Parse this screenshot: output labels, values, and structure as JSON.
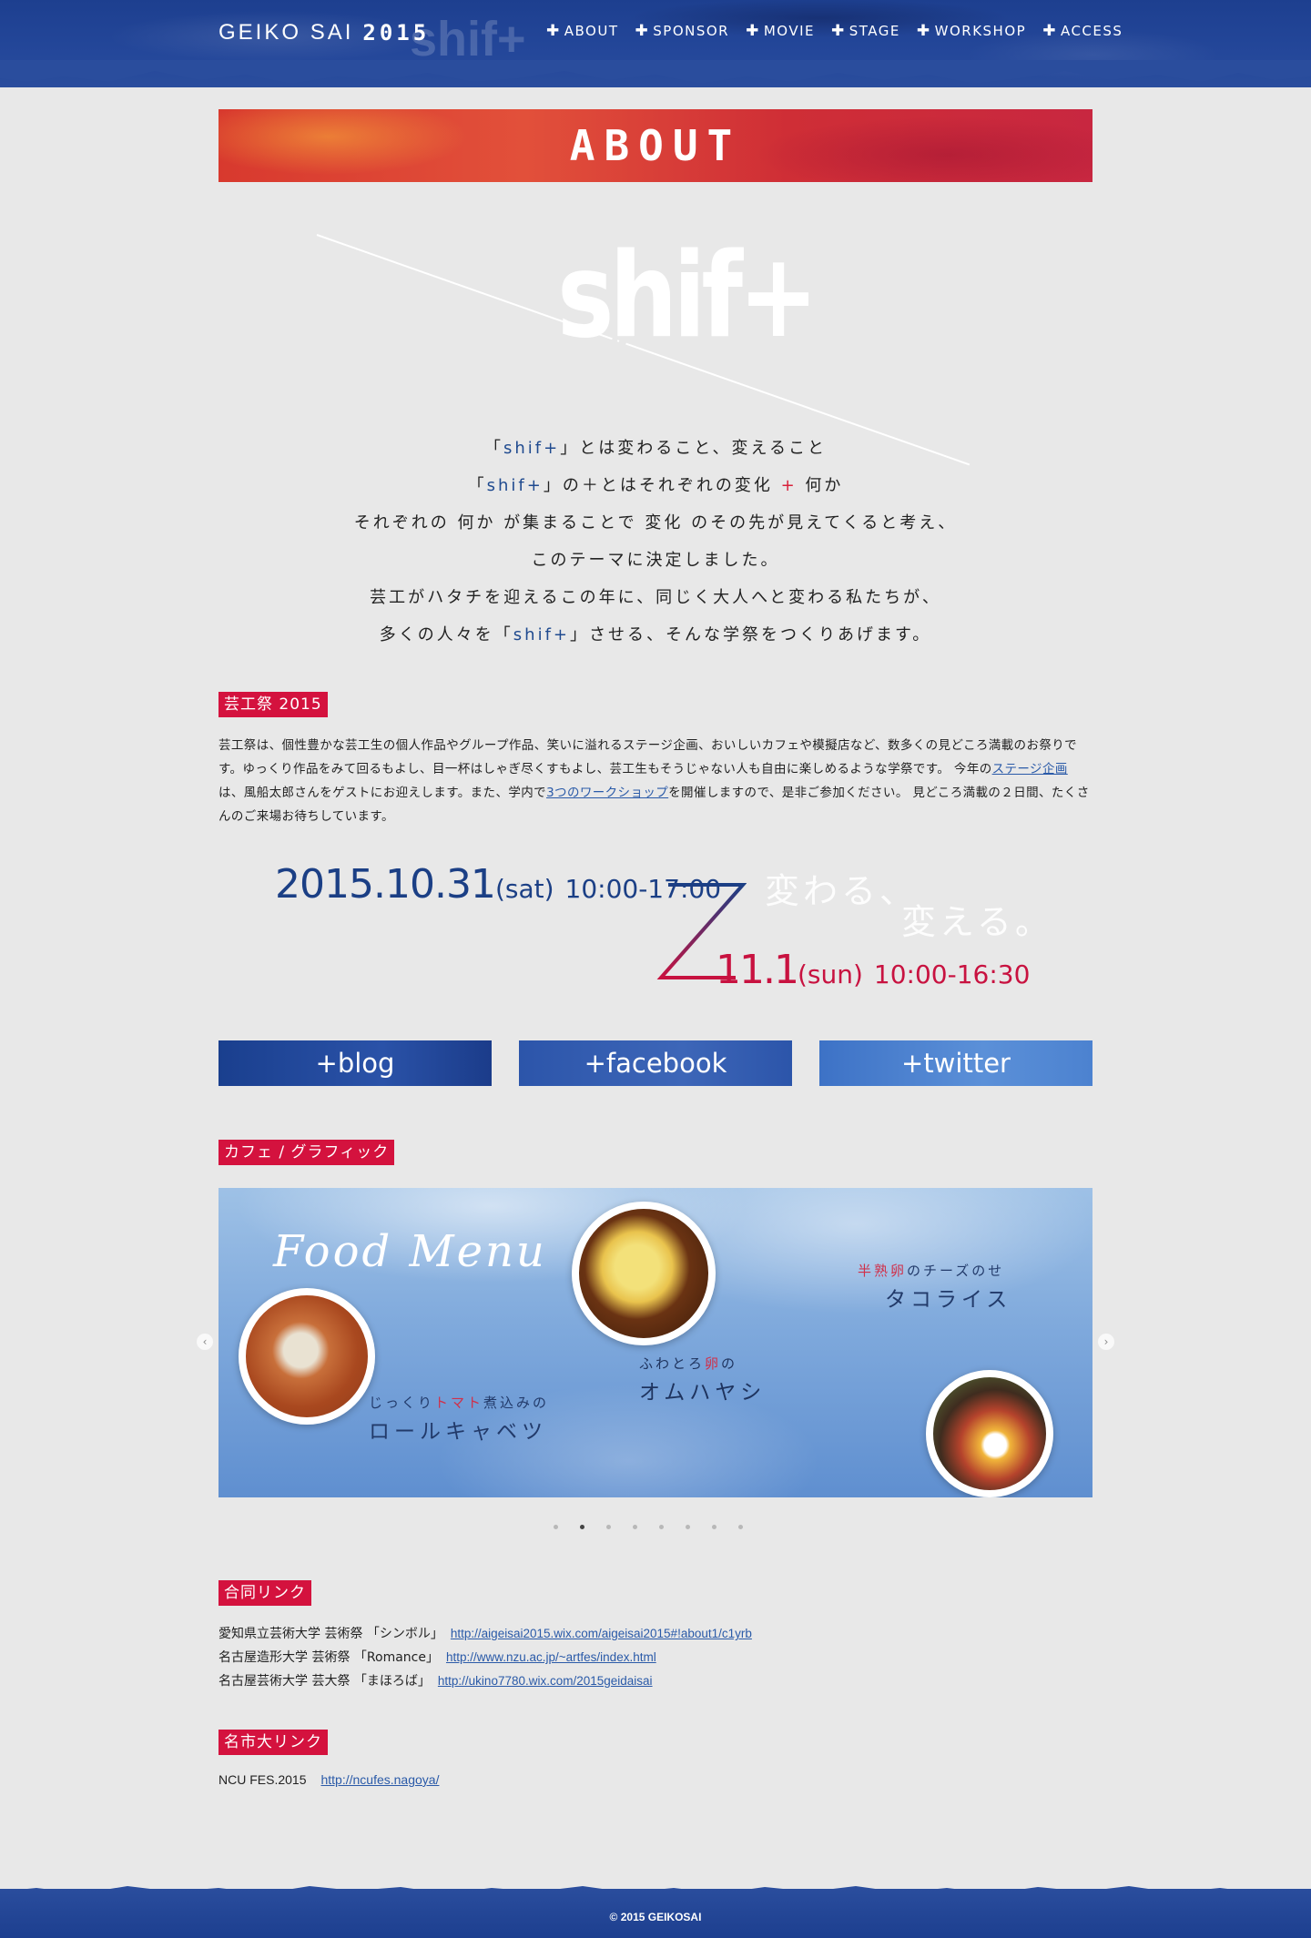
{
  "header": {
    "brand_name": "GEIKO SAI",
    "brand_year": "2015",
    "brand_ghost": "shif+",
    "nav": [
      "ABOUT",
      "SPONSOR",
      "MOVIE",
      "STAGE",
      "WORKSHOP",
      "ACCESS"
    ]
  },
  "about": {
    "banner": "ABOUT"
  },
  "shift_logo": "shif+",
  "intro": {
    "line1_pre": "「",
    "line1_kw": "shif+",
    "line1_post": "」とは変わること、変えること",
    "line2_pre": "「",
    "line2_kw": "shif+",
    "line2_mid": "」の＋とはそれぞれの変化 ",
    "line2_plus": "+",
    "line2_post": " 何か",
    "line3": "それぞれの 何か が集まることで 変化 のその先が見えてくると考え、",
    "line4": "このテーマに決定しました。",
    "line5": "芸工がハタチを迎えるこの年に、同じく大人へと変わる私たちが、",
    "line6_pre": "多くの人々を「",
    "line6_kw": "shif+",
    "line6_post": "」させる、そんな学祭をつくりあげます。"
  },
  "geikosai": {
    "label": "芸工祭 2015",
    "text_1": "芸工祭は、個性豊かな芸工生の個人作品やグループ作品、笑いに溢れるステージ企画、おいしいカフェや模擬店など、数多くの見どころ満載のお祭りです。ゆっくり作品をみて回るもよし、目一杯はしゃぎ尽くすもよし、芸工生もそうじゃない人も自由に楽しめるような学祭です。 今年の",
    "link_stage": "ステージ企画",
    "text_2": "は、風船太郎さんをゲストにお迎えします。また、学内で",
    "link_workshop": "3つのワークショップ",
    "text_3": "を開催しますので、是非ご参加ください。 見どころ満載の２日間、たくさんのご来場お待ちしています。"
  },
  "dates": {
    "day1_date": "2015.10.31",
    "day1_dow": "(sat)",
    "day1_time": "10:00-17:00",
    "day2_date": "11.1",
    "day2_dow": "(sun)",
    "day2_time": "10:00-16:30",
    "slogan_1": "変わる、",
    "slogan_2": "変える。"
  },
  "social": {
    "blog": "+blog",
    "facebook": "+facebook",
    "twitter": "+twitter"
  },
  "cafe": {
    "label": "カフェ / グラフィック",
    "slide_title": "Food Menu",
    "dishes": [
      {
        "desc_pre": "じっくり",
        "desc_accent": "トマト",
        "desc_post": "煮込みの",
        "name": "ロールキャベツ"
      },
      {
        "desc_pre": "ふわとろ",
        "desc_accent": "卵",
        "desc_post": "の",
        "name": "オムハヤシ"
      },
      {
        "desc_pre": "",
        "desc_accent": "半熟卵",
        "desc_post": "のチーズのせ",
        "name": "タコライス"
      }
    ],
    "prev_icon": "chevron-left-icon",
    "next_icon": "chevron-right-icon",
    "slide_count": 8,
    "active_slide": 2
  },
  "joint_links": {
    "label": "合同リンク",
    "items": [
      {
        "name": "愛知県立芸術大学 芸術祭 「シンボル」",
        "url": "http://aigeisai2015.wix.com/aigeisai2015#!about1/c1yrb"
      },
      {
        "name": "名古屋造形大学 芸術祭 「Romance」",
        "url": "http://www.nzu.ac.jp/~artfes/index.html"
      },
      {
        "name": "名古屋芸術大学 芸大祭 「まほろば」",
        "url": "http://ukino7780.wix.com/2015geidaisai"
      }
    ]
  },
  "ncu_links": {
    "label": "名市大リンク",
    "name": "NCU FES.2015",
    "url": "http://ncufes.nagoya/"
  },
  "footer": {
    "copyright": "© 2015 GEIKOSAI"
  },
  "colors": {
    "header_blue": "#1d3f8f",
    "accent_red": "#d4123e",
    "date_blue": "#1b3f85",
    "date_red": "#c81240",
    "link_blue": "#2a5aa8"
  }
}
